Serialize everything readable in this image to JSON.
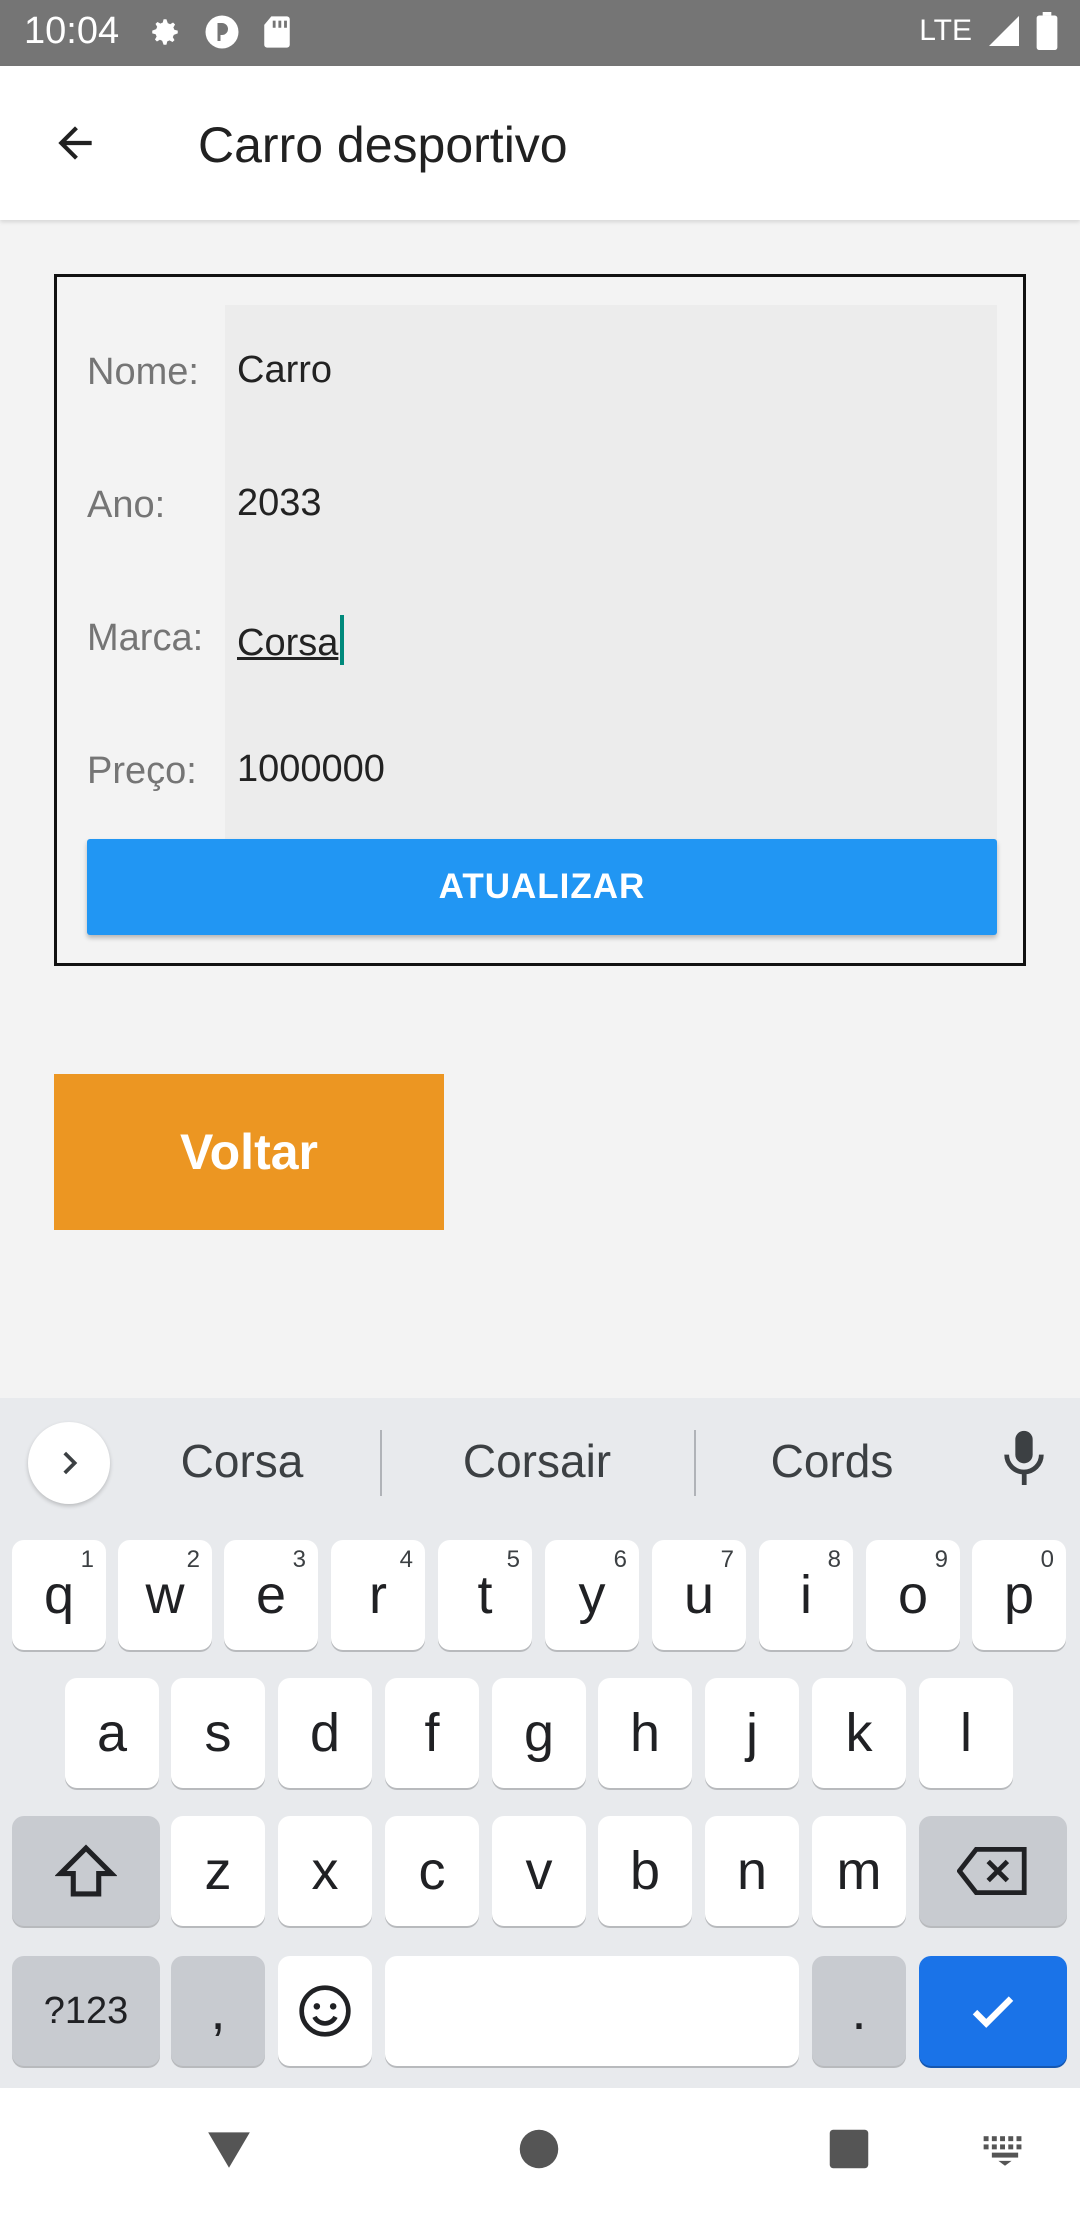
{
  "status_bar": {
    "time": "10:04",
    "network": "LTE"
  },
  "app_bar": {
    "title": "Carro desportivo"
  },
  "form": {
    "fields": [
      {
        "label": "Nome:",
        "value": "Carro"
      },
      {
        "label": "Ano:",
        "value": "2033"
      },
      {
        "label": "Marca:",
        "value": "Corsa"
      },
      {
        "label": "Preço:",
        "value": "1000000"
      }
    ],
    "update_label": "ATUALIZAR"
  },
  "back_button_label": "Voltar",
  "keyboard": {
    "suggestions": [
      "Corsa",
      "Corsair",
      "Cords"
    ],
    "row1": [
      {
        "k": "q",
        "n": "1"
      },
      {
        "k": "w",
        "n": "2"
      },
      {
        "k": "e",
        "n": "3"
      },
      {
        "k": "r",
        "n": "4"
      },
      {
        "k": "t",
        "n": "5"
      },
      {
        "k": "y",
        "n": "6"
      },
      {
        "k": "u",
        "n": "7"
      },
      {
        "k": "i",
        "n": "8"
      },
      {
        "k": "o",
        "n": "9"
      },
      {
        "k": "p",
        "n": "0"
      }
    ],
    "row2": [
      "a",
      "s",
      "d",
      "f",
      "g",
      "h",
      "j",
      "k",
      "l"
    ],
    "row3": [
      "z",
      "x",
      "c",
      "v",
      "b",
      "n",
      "m"
    ],
    "symbols_label": "?123",
    "comma": ",",
    "period": "."
  },
  "colors": {
    "accent_blue": "#2196f3",
    "voltar_orange": "#ec9622",
    "keyboard_enter": "#1a73e8",
    "caret": "#00897b"
  }
}
